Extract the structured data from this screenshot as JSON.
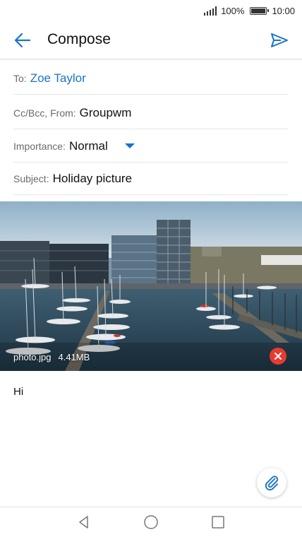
{
  "status": {
    "battery": "100%",
    "time": "10:00"
  },
  "header": {
    "title": "Compose"
  },
  "fields": {
    "to_label": "To:",
    "to_value": "Zoe Taylor",
    "cc_label": "Cc/Bcc, From:",
    "cc_value": "Groupwm",
    "importance_label": "Importance:",
    "importance_value": "Normal",
    "subject_label": "Subject:",
    "subject_value": "Holiday picture"
  },
  "attachment": {
    "filename": "photo.jpg",
    "size": "4.41MB"
  },
  "body": {
    "text": "Hi"
  },
  "colors": {
    "accent": "#1a73c8",
    "remove": "#e83b30"
  },
  "icons": {
    "back": "arrow-left-icon",
    "send": "send-icon",
    "remove": "close-icon",
    "attach": "paperclip-icon",
    "nav_back": "triangle-back-icon",
    "nav_home": "circle-home-icon",
    "nav_recent": "square-recent-icon"
  }
}
